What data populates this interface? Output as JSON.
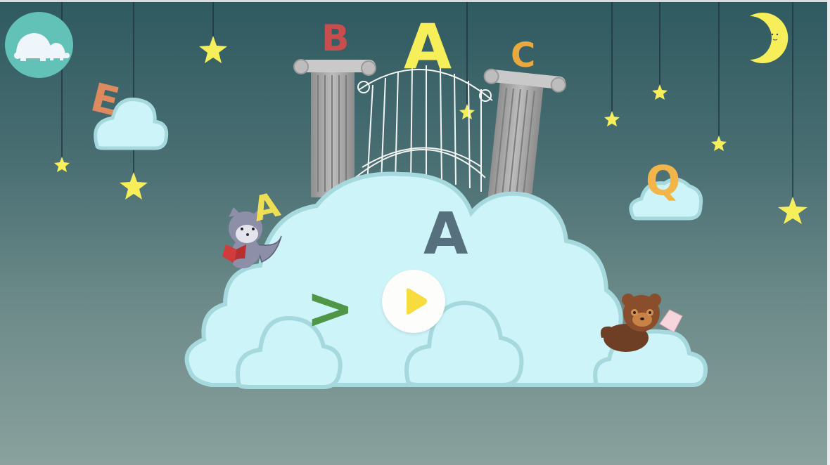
{
  "scene": {
    "letters": [
      "B",
      "A",
      "C",
      "E",
      "Q",
      "A",
      ">",
      "A"
    ],
    "colors": {
      "background_top": "#2f5a60",
      "background_bottom": "#8aa19d",
      "cloud_fill": "#cdf4f8",
      "cloud_edge": "#a6d9de",
      "star": "#f7ef5a",
      "logo_bg": "#63c2b7",
      "play_icon": "#f6dc3f"
    }
  },
  "icons": {
    "logo": "turtle-logo-icon",
    "play": "play-icon",
    "moon": "moon-icon",
    "star": "star-icon",
    "cat": "cat-reading-icon",
    "bear": "bear-reading-icon"
  }
}
